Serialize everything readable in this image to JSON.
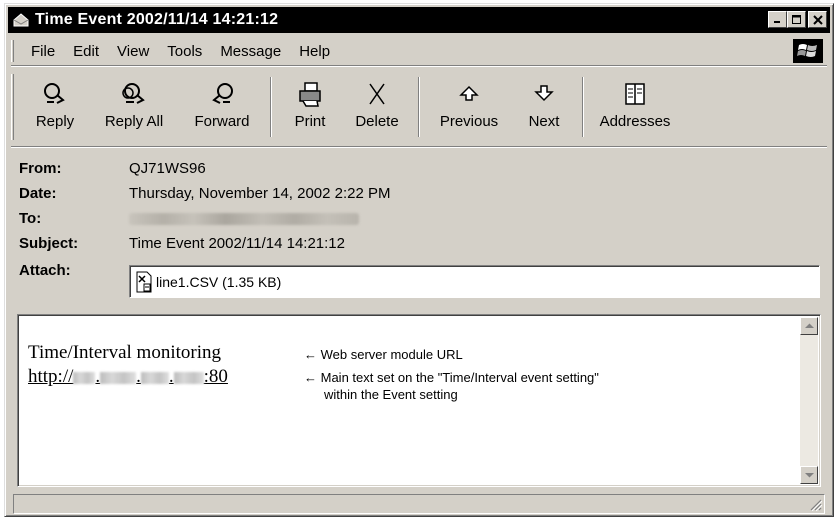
{
  "window": {
    "title": "Time Event 2002/11/14 14:21:12"
  },
  "menu": [
    {
      "id": "file",
      "label": "File"
    },
    {
      "id": "edit",
      "label": "Edit"
    },
    {
      "id": "view",
      "label": "View"
    },
    {
      "id": "tools",
      "label": "Tools"
    },
    {
      "id": "message",
      "label": "Message"
    },
    {
      "id": "help",
      "label": "Help"
    }
  ],
  "toolbar": {
    "reply": "Reply",
    "reply_all": "Reply All",
    "forward": "Forward",
    "print": "Print",
    "delete": "Delete",
    "previous": "Previous",
    "next": "Next",
    "addresses": "Addresses"
  },
  "headers": {
    "from_label": "From:",
    "from_value": "QJ71WS96",
    "date_label": "Date:",
    "date_value": "Thursday, November 14, 2002 2:22 PM",
    "to_label": "To:",
    "subject_label": "Subject:",
    "subject_value": "Time Event 2002/11/14 14:21:12",
    "attach_label": "Attach:",
    "attach_value": "line1.CSV (1.35 KB)"
  },
  "body": {
    "line1": "Time/Interval monitoring",
    "link_prefix": "http://",
    "link_dot1": ".",
    "link_dot2": ".",
    "link_dot3": ".",
    "link_suffix": ":80"
  },
  "annotations": {
    "arrow1": "←",
    "note1": "Web server module URL",
    "arrow2": "←",
    "note2_line1": "Main text set on the \"Time/Interval event setting\"",
    "note2_line2": "within the Event setting"
  },
  "icons": {
    "title": "mail-envelope-icon",
    "reply": "reply-icon",
    "reply_all": "reply-all-icon",
    "forward": "forward-icon",
    "print": "printer-icon",
    "delete": "delete-x-icon",
    "previous": "up-arrow-icon",
    "next": "down-arrow-icon",
    "addresses": "address-book-icon",
    "attachment": "csv-file-icon",
    "brand": "windows-logo-icon"
  }
}
